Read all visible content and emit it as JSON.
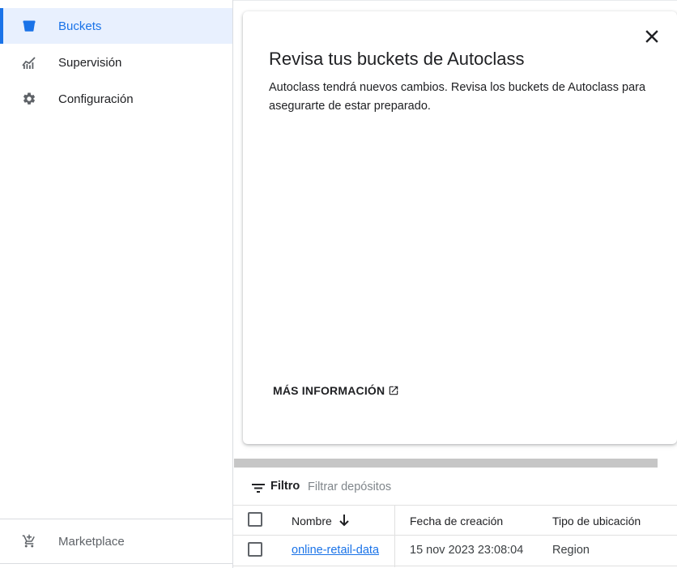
{
  "sidebar": {
    "items": [
      {
        "label": "Buckets",
        "icon": "bucket-icon",
        "active": true
      },
      {
        "label": "Supervisión",
        "icon": "monitoring-chart-icon",
        "active": false
      },
      {
        "label": "Configuración",
        "icon": "gear-icon",
        "active": false
      }
    ],
    "footer": {
      "label": "Marketplace",
      "icon": "cart-plus-icon"
    }
  },
  "banner": {
    "title": "Revisa tus buckets de Autoclass",
    "body": "Autoclass tendrá nuevos cambios. Revisa los buckets de Autoclass para asegurarte de estar preparado.",
    "link_label": "MÁS INFORMACIÓN",
    "close_icon": "close-icon",
    "link_icon": "open-in-new-icon"
  },
  "filter": {
    "label": "Filtro",
    "placeholder": "Filtrar depósitos",
    "icon": "filter-list-icon"
  },
  "table": {
    "columns": [
      "Nombre",
      "Fecha de creación",
      "Tipo de ubicación"
    ],
    "sort_icon": "arrow-down-icon",
    "rows": [
      {
        "name": "online-retail-data",
        "created": "15 nov 2023 23:08:04",
        "location_type": "Region"
      }
    ]
  },
  "colors": {
    "accent": "#1a73e8",
    "active_bg": "#e8f0fe"
  }
}
